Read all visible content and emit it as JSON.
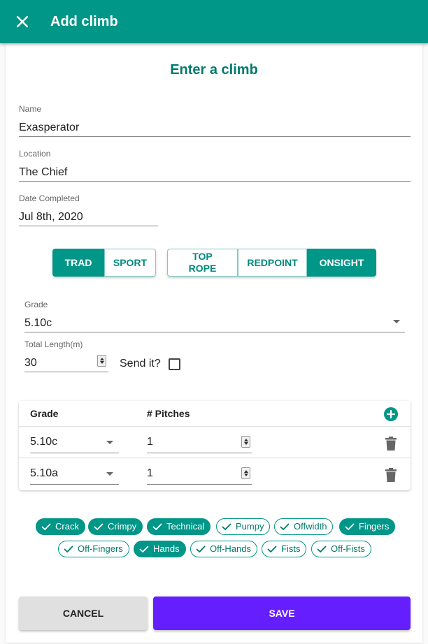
{
  "appbar": {
    "title": "Add climb",
    "close_icon": "close-icon"
  },
  "form": {
    "heading": "Enter a climb",
    "name": {
      "label": "Name",
      "value": "Exasperator"
    },
    "location": {
      "label": "Location",
      "value": "The Chief"
    },
    "date": {
      "label": "Date Completed",
      "value": "Jul 8th, 2020"
    }
  },
  "style_group": [
    {
      "label": "TRAD",
      "selected": true
    },
    {
      "label": "SPORT",
      "selected": false
    }
  ],
  "type_group": [
    {
      "label": "TOP ROPE",
      "selected": false
    },
    {
      "label": "REDPOINT",
      "selected": false
    },
    {
      "label": "ONSIGHT",
      "selected": true
    }
  ],
  "grade": {
    "label": "Grade",
    "value": "5.10c"
  },
  "length": {
    "label": "Total Length(m)",
    "value": "30"
  },
  "send": {
    "label": "Send it?",
    "checked": false
  },
  "pitches": {
    "headers": {
      "grade": "Grade",
      "pitches": "# Pitches"
    },
    "rows": [
      {
        "grade": "5.10c",
        "pitches": "1"
      },
      {
        "grade": "5.10a",
        "pitches": "1"
      }
    ]
  },
  "tags": [
    {
      "label": "Crack",
      "selected": true
    },
    {
      "label": "Crimpy",
      "selected": true
    },
    {
      "label": "Technical",
      "selected": true
    },
    {
      "label": "Pumpy",
      "selected": false
    },
    {
      "label": "Offwidth",
      "selected": false
    },
    {
      "label": "Fingers",
      "selected": true
    },
    {
      "label": "Off-Fingers",
      "selected": false
    },
    {
      "label": "Hands",
      "selected": true
    },
    {
      "label": "Off-Hands",
      "selected": false
    },
    {
      "label": "Fists",
      "selected": false
    },
    {
      "label": "Off-Fists",
      "selected": false
    }
  ],
  "actions": {
    "cancel": "CANCEL",
    "save": "SAVE"
  },
  "colors": {
    "primary": "#009688",
    "save": "#651fff",
    "cancel": "#e0e0e0"
  }
}
